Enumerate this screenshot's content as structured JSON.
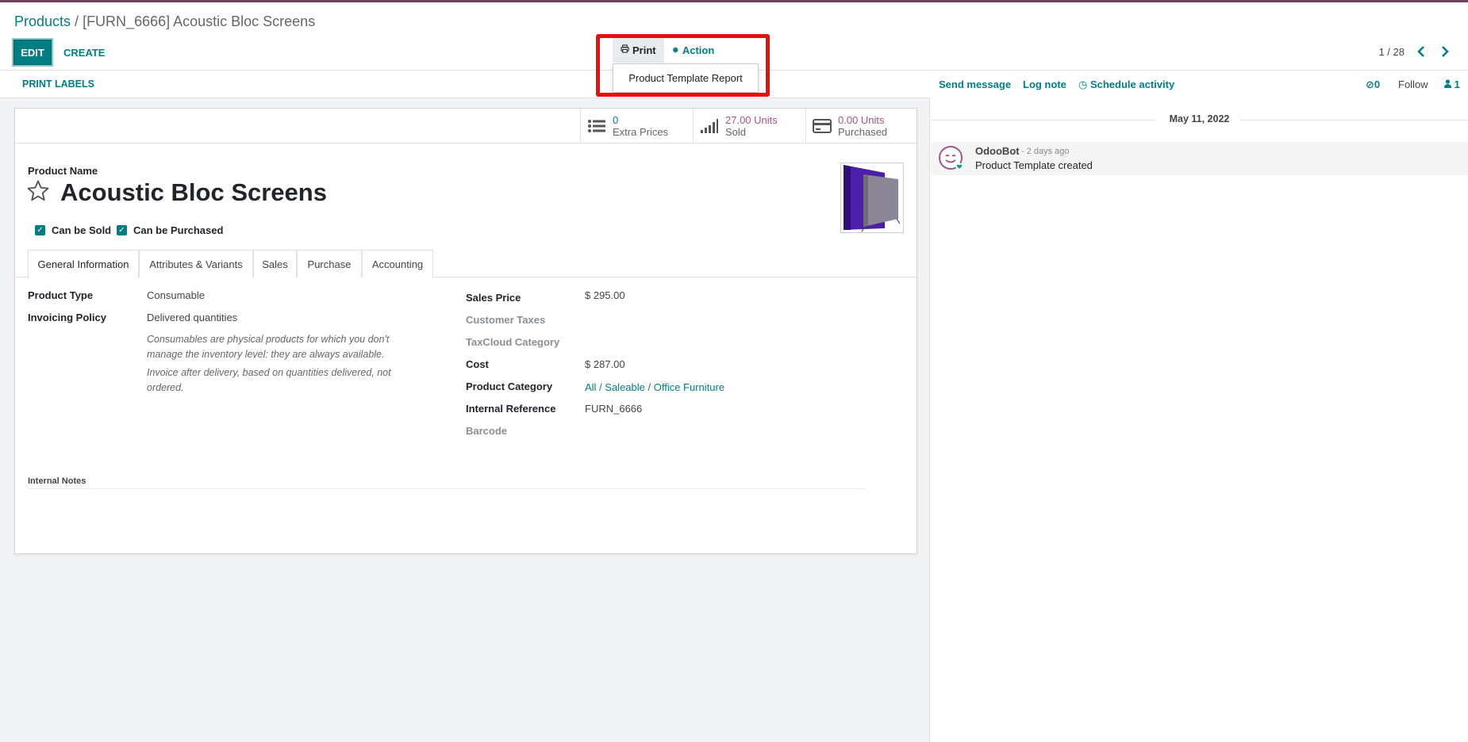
{
  "breadcrumb": {
    "parent": "Products",
    "separator": " / ",
    "current": "[FURN_6666] Acoustic Bloc Screens"
  },
  "toolbar": {
    "edit_label": "EDIT",
    "create_label": "CREATE"
  },
  "actions": {
    "print_label": "Print",
    "action_label": "Action",
    "print_icon": "printer-icon",
    "action_icon": "gear-icon",
    "print_menu": [
      "Product Template Report"
    ]
  },
  "pager": {
    "value": "1 / 28",
    "prev_icon": "chevron-left-icon",
    "next_icon": "chevron-right-icon"
  },
  "status_bar": {
    "print_labels": "PRINT LABELS"
  },
  "smart_buttons": [
    {
      "icon": "list-icon",
      "value": "0",
      "label": "Extra Prices"
    },
    {
      "icon": "signal-bars-icon",
      "value": "27.00 Units",
      "label": "Sold"
    },
    {
      "icon": "credit-card-icon",
      "value": "0.00 Units",
      "label": "Purchased"
    }
  ],
  "product": {
    "name_label": "Product Name",
    "name": "Acoustic Bloc Screens",
    "can_be_sold_label": "Can be Sold",
    "can_be_purchased_label": "Can be Purchased",
    "can_be_sold": true,
    "can_be_purchased": true
  },
  "tabs": [
    "General Information",
    "Attributes & Variants",
    "Sales",
    "Purchase",
    "Accounting"
  ],
  "general": {
    "product_type_label": "Product Type",
    "product_type": "Consumable",
    "invoicing_policy_label": "Invoicing Policy",
    "invoicing_policy": "Delivered quantities",
    "help_consumable": "Consumables are physical products for which you don't manage the inventory level: they are always available.",
    "help_invoice": "Invoice after delivery, based on quantities delivered, not ordered.",
    "sales_price_label": "Sales Price",
    "sales_price": "$ 295.00",
    "customer_taxes_label": "Customer Taxes",
    "taxcloud_label": "TaxCloud Category",
    "cost_label": "Cost",
    "cost": "$ 287.00",
    "category_label": "Product Category",
    "category": "All / Saleable / Office Furniture",
    "internal_ref_label": "Internal Reference",
    "internal_ref": "FURN_6666",
    "barcode_label": "Barcode",
    "internal_notes_label": "Internal Notes"
  },
  "chatter": {
    "send_message": "Send message",
    "log_note": "Log note",
    "schedule_activity": "Schedule activity",
    "attachments_count": "0",
    "follow": "Follow",
    "followers_count": "1",
    "date": "May 11, 2022",
    "messages": [
      {
        "author": "OdooBot",
        "time": "- 2 days ago",
        "body": "Product Template created"
      }
    ]
  },
  "colors": {
    "brand": "#71405e",
    "accent": "#017e84",
    "highlight": "#ee0d0d"
  }
}
